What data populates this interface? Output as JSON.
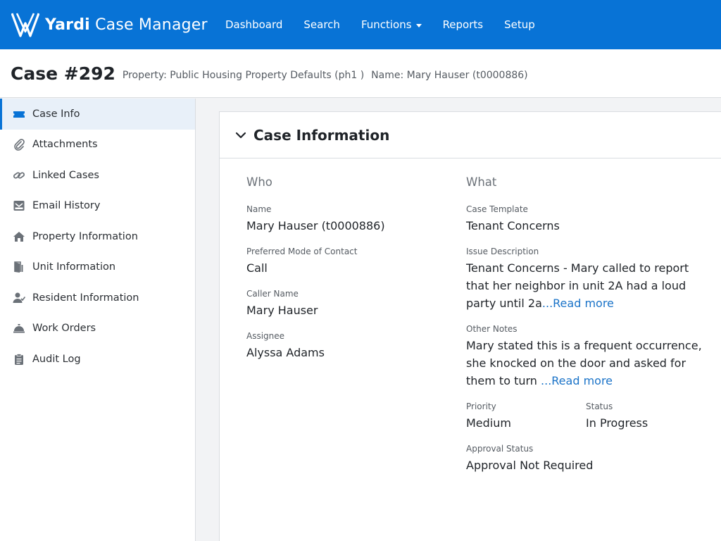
{
  "brand": {
    "name_bold": "Yardi",
    "name_rest": " Case Manager"
  },
  "nav": [
    {
      "label": "Dashboard"
    },
    {
      "label": "Search"
    },
    {
      "label": "Functions"
    },
    {
      "label": "Reports"
    },
    {
      "label": "Setup"
    }
  ],
  "header": {
    "title": "Case #292",
    "property": "Property: Public Housing Property Defaults (ph1 )",
    "name": "Name: Mary Hauser (t0000886)"
  },
  "sidebar": {
    "items": [
      {
        "label": "Case Info",
        "icon": "ticket-icon"
      },
      {
        "label": "Attachments",
        "icon": "paperclip-icon"
      },
      {
        "label": "Linked Cases",
        "icon": "link-icon"
      },
      {
        "label": "Email History",
        "icon": "mail-icon"
      },
      {
        "label": "Property Information",
        "icon": "home-icon"
      },
      {
        "label": "Unit Information",
        "icon": "door-icon"
      },
      {
        "label": "Resident Information",
        "icon": "user-check-icon"
      },
      {
        "label": "Work Orders",
        "icon": "service-bell-icon"
      },
      {
        "label": "Audit Log",
        "icon": "clipboard-icon"
      }
    ]
  },
  "panel": {
    "title": "Case Information",
    "who": {
      "heading": "Who",
      "name_label": "Name",
      "name_value": "Mary Hauser (t0000886)",
      "contact_label": "Preferred Mode of Contact",
      "contact_value": "Call",
      "caller_label": "Caller Name",
      "caller_value": "Mary Hauser",
      "assignee_label": "Assignee",
      "assignee_value": "Alyssa Adams"
    },
    "what": {
      "heading": "What",
      "template_label": "Case Template",
      "template_value": "Tenant Concerns",
      "issue_label": "Issue Description",
      "issue_value": "Tenant Concerns - Mary called to report that her neighbor in unit 2A had a loud party until 2a",
      "issue_more": "...Read more",
      "notes_label": "Other Notes",
      "notes_value": "Mary stated this is a frequent occurrence, she knocked on the door and asked for them to turn ",
      "notes_more": "...Read more",
      "priority_label": "Priority",
      "priority_value": "Medium",
      "status_label": "Status",
      "status_value": "In Progress",
      "approval_label": "Approval Status",
      "approval_value": "Approval Not Required"
    }
  },
  "colors": {
    "brand_blue": "#0873d6",
    "link_blue": "#1a73c8",
    "active_bg": "#e8f0f9"
  }
}
